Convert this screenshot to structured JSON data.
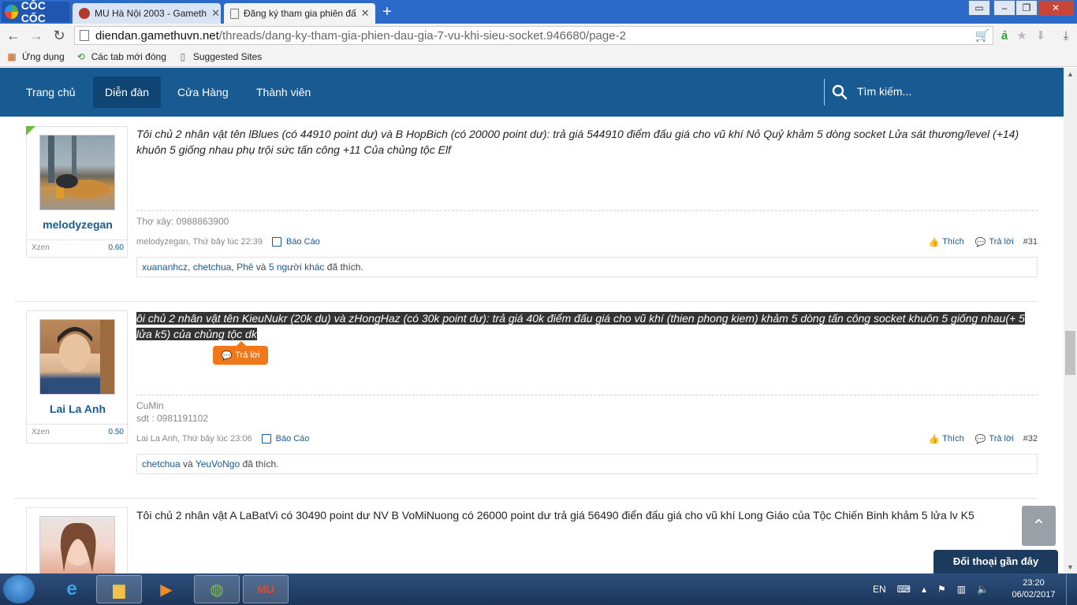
{
  "browser": {
    "brand": "CỐC CỐC",
    "tabs": [
      {
        "title": "MU Hà Nội 2003 - Gameth",
        "active": false
      },
      {
        "title": "Đăng ký tham gia phiên đấ",
        "active": true
      }
    ],
    "address": {
      "host": "diendan.gamethuvn.net",
      "path": "/threads/dang-ky-tham-gia-phien-dau-gia-7-vu-khi-sieu-socket.946680/page-2"
    },
    "bookmarks": [
      "Ứng dụng",
      "Các tab mới đóng",
      "Suggested Sites"
    ]
  },
  "site_nav": {
    "items": [
      "Trang chủ",
      "Diễn đàn",
      "Cửa Hàng",
      "Thành viên"
    ],
    "active_index": 1,
    "search_placeholder": "Tìm kiếm..."
  },
  "posts": [
    {
      "username": "melodyzegan",
      "stat_label": "Xzen",
      "stat_value": "0.60",
      "message": "Tôi chủ 2 nhân vật tên lBlues (có 44910 point dư) và B HopBich (có 20000 point dư): trả giá 544910 điểm đấu giá cho vũ khí Nỏ Quỷ khảm 5 dòng socket Lửa sát thương/level (+14) khuôn 5 giống nhau phụ trội sức tấn công +11 Của chủng tộc Elf",
      "signature": [
        "Thợ xây: 0988863900"
      ],
      "meta": "melodyzegan, Thứ bảy lúc 22:39",
      "report": "Báo Cáo",
      "like": "Thích",
      "reply": "Trả lời",
      "number": "#31",
      "likers": [
        "xuananhcz",
        "chetchua",
        "Phê"
      ],
      "likes_and": "và",
      "likes_more": "5 người khác",
      "likes_suffix": "đã thích."
    },
    {
      "username": "Lai La Anh",
      "stat_label": "Xzen",
      "stat_value": "0.50",
      "message": "ôi chủ 2 nhân vật tên KieuNukr (20k du) và zHongHaz (có 30k point dư): trả giá 40k điểm đấu giá cho vũ khí (thien phong kiem) khảm 5 dòng tấn công socket khuôn 5 giống nhau(+ 5 lửa k5) của chủng tộc dk",
      "quote_button": "Trả lời",
      "signature": [
        "CuMin",
        "sdt : 0981191102"
      ],
      "meta": "Lai La Anh, Thứ bảy lúc 23:06",
      "report": "Báo Cáo",
      "like": "Thích",
      "reply": "Trả lời",
      "number": "#32",
      "likers": [
        "chetchua",
        "YeuVoNgo"
      ],
      "likes_and": "và",
      "likes_suffix": "đã thích."
    },
    {
      "message": "Tôi chủ 2 nhân vật A LaBatVi có 30490 point dư NV B VoMiNuong có 26000 point dư trả giá 56490 điển đấu giá cho vũ khí Long Giáo của Tộc Chiến Binh khảm 5 lửa lv K5"
    }
  ],
  "chat_bar": "Đối thoại gần đây",
  "taskbar": {
    "language": "EN",
    "time": "23:20",
    "date": "06/02/2017"
  },
  "colors": {
    "nav_bg": "#185a92",
    "link": "#185a92",
    "quote_button": "#f07818",
    "chat_bar": "#1b3a5c"
  }
}
